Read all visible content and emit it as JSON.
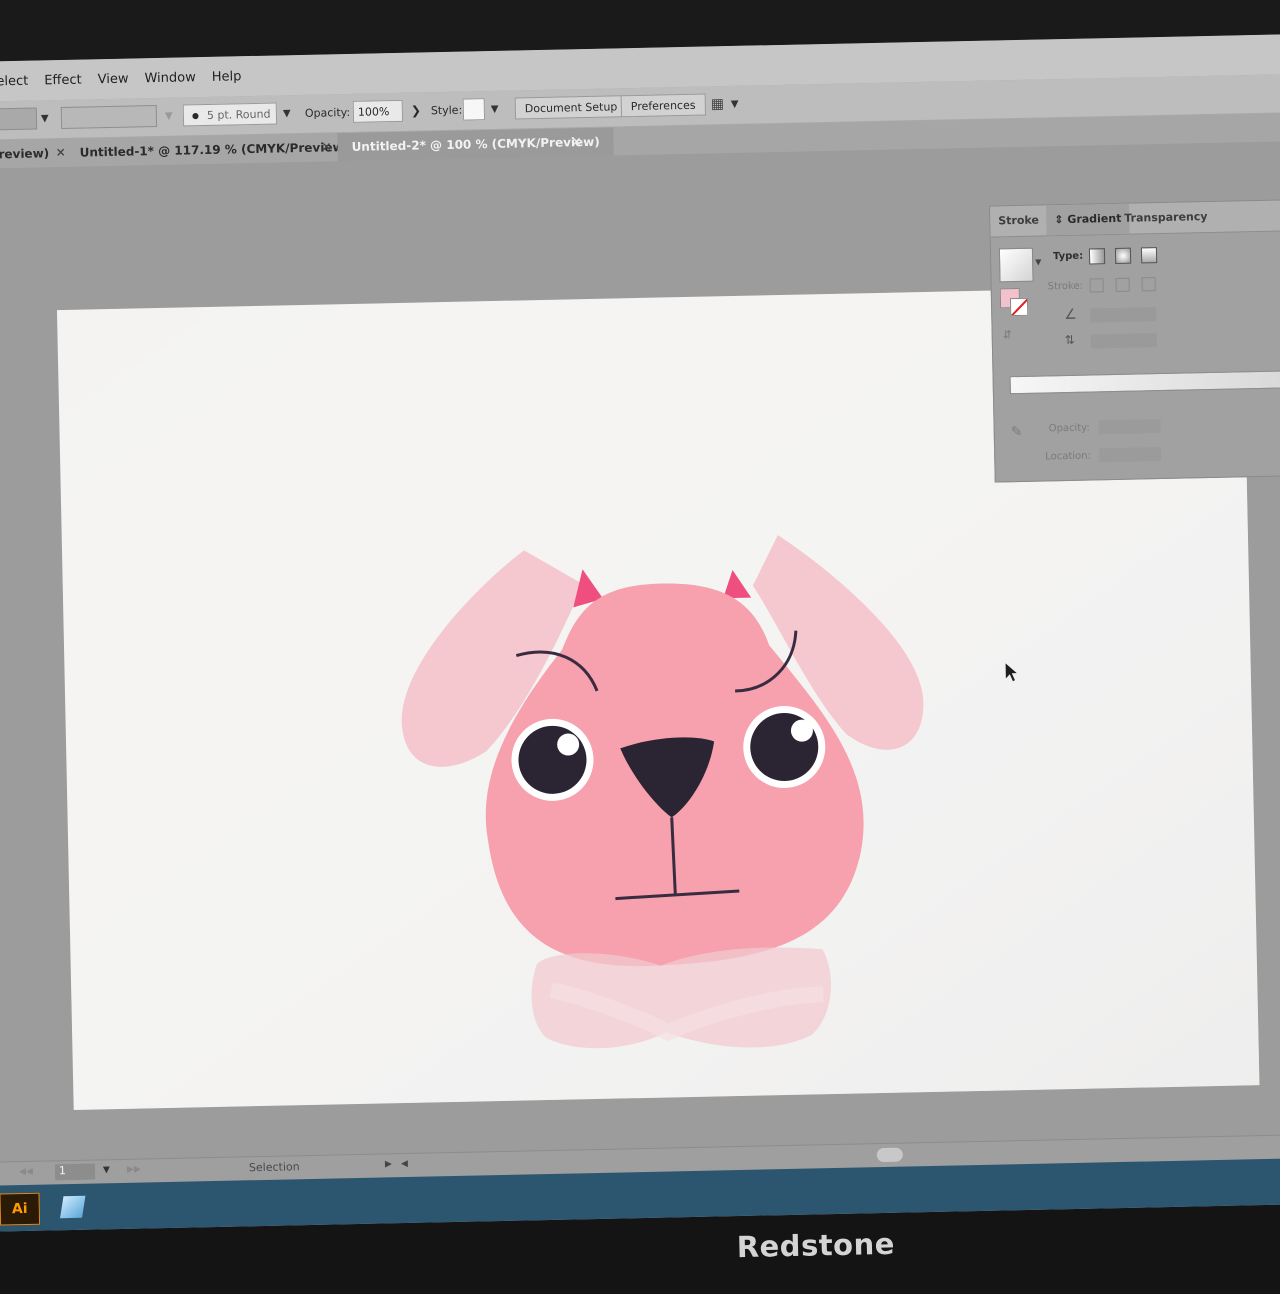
{
  "menu": [
    "Select",
    "Effect",
    "View",
    "Window",
    "Help"
  ],
  "control": {
    "brush": "5 pt. Round",
    "opacity_label": "Opacity:",
    "opacity_value": "100%",
    "style_label": "Style:",
    "document_setup": "Document Setup",
    "preferences": "Preferences"
  },
  "tabs": [
    {
      "label": "Preview)",
      "active": false
    },
    {
      "label": "Untitled-1* @ 117.19 % (CMYK/Preview)",
      "active": false
    },
    {
      "label": "Untitled-2* @ 100 % (CMYK/Preview)",
      "active": true
    }
  ],
  "gradient_panel": {
    "tabs": [
      "Stroke",
      "Gradient",
      "Transparency"
    ],
    "active_tab": "Gradient",
    "type_label": "Type:",
    "stroke_label": "Stroke:",
    "opacity_label": "Opacity:",
    "location_label": "Location:"
  },
  "status": {
    "page": "1",
    "tool": "Selection"
  },
  "taskbar": {
    "app_badge": "Ai"
  },
  "monitor_brand": "Redstone",
  "colors": {
    "face": "#f6a1ad",
    "ears": "#f5c7cf",
    "ear_inner": "#ef4f7e",
    "features": "#2b2433",
    "artboard": "#f4f3f2",
    "ui_gray": "#c6c6c6"
  }
}
